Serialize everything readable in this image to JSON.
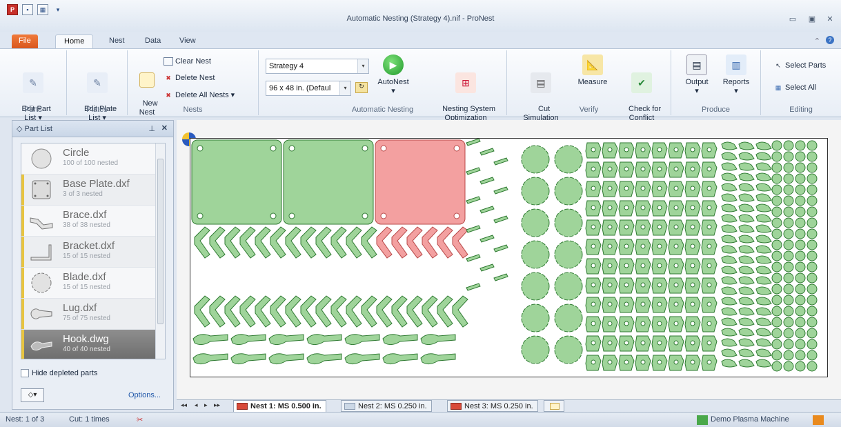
{
  "window": {
    "title": "Automatic Nesting (Strategy 4).nif - ProNest"
  },
  "ribbon_tabs": [
    "File",
    "Home",
    "Nest",
    "Data",
    "View"
  ],
  "ribbon": {
    "parts_group": {
      "label": "Parts",
      "button": "Edit Part\nList"
    },
    "plates_group": {
      "label": "Plates",
      "button": "Edit Plate\nList"
    },
    "nests_group": {
      "label": "Nests",
      "new_nest": "New\nNest",
      "clear": "Clear Nest",
      "delete": "Delete Nest",
      "delete_all": "Delete All Nests"
    },
    "auto_group": {
      "label": "Automatic Nesting",
      "strategy": "Strategy 4",
      "plate": "96 x 48 in. (Defaul",
      "autonest": "AutoNest",
      "optimization": "Nesting System\nOptimization"
    },
    "verify_group": {
      "label": "Verify",
      "cut_sim": "Cut\nSimulation",
      "measure": "Measure",
      "check": "Check for\nConflict"
    },
    "produce_group": {
      "label": "Produce",
      "output": "Output",
      "reports": "Reports"
    },
    "editing_group": {
      "label": "Editing",
      "select_parts": "Select Parts",
      "select_all": "Select All"
    }
  },
  "part_list": {
    "title": "Part List",
    "items": [
      {
        "name": "Circle",
        "count": "100 of 100 nested",
        "icon": "circle-icon"
      },
      {
        "name": "Base Plate.dxf",
        "count": "3 of 3 nested",
        "icon": "plate-icon"
      },
      {
        "name": "Brace.dxf",
        "count": "38 of 38 nested",
        "icon": "brace-icon"
      },
      {
        "name": "Bracket.dxf",
        "count": "15 of 15 nested",
        "icon": "bracket-icon"
      },
      {
        "name": "Blade.dxf",
        "count": "15 of 15 nested",
        "icon": "blade-icon"
      },
      {
        "name": "Lug.dxf",
        "count": "75 of 75 nested",
        "icon": "lug-icon"
      },
      {
        "name": "Hook.dwg",
        "count": "40 of 40 nested",
        "icon": "hook-icon"
      }
    ],
    "hide_depleted": "Hide depleted parts",
    "options": "Options..."
  },
  "sheet_tabs": [
    {
      "label": "Nest 1: MS 0.500 in.",
      "active": true
    },
    {
      "label": "Nest 2: MS 0.250 in.",
      "active": false
    },
    {
      "label": "Nest 3: MS 0.250 in.",
      "active": false
    }
  ],
  "status": {
    "nest": "Nest: 1 of 3",
    "cut": "Cut: 1 times",
    "machine": "Demo Plasma Machine"
  },
  "colors": {
    "part_green": "#9fd49a",
    "part_red": "#f3a0a0",
    "accent_orange": "#e36a2a"
  }
}
